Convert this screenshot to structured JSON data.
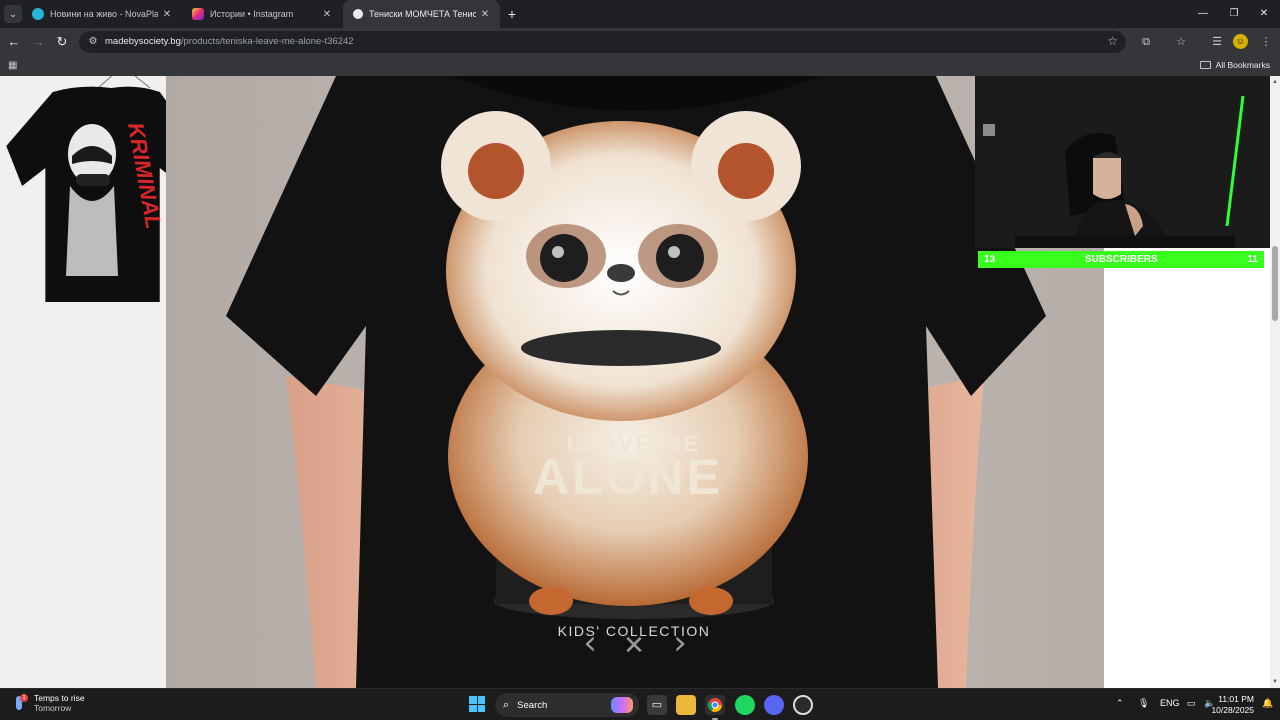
{
  "browser": {
    "tabs": [
      {
        "title": "Новини на живо - NovaPlay",
        "close": "✕"
      },
      {
        "title": "Истории • Instagram",
        "close": "✕"
      },
      {
        "title": "Тениски МОМЧЕТА Тениска ЛЕА",
        "close": "✕"
      }
    ],
    "new_tab": "+",
    "window_controls": {
      "minimize": "—",
      "restore": "❐",
      "close": "✕"
    },
    "url_domain": "madebysociety.bg",
    "url_path": "/products/teniska-leave-me-alone-t36242",
    "bookmarks_label": "All Bookmarks"
  },
  "product": {
    "print_title_small": "LEAVE ME",
    "print_title_big": "ALONE",
    "print_footer": "KIDS' COLLECTION",
    "thumb_text": "KRIMINAL",
    "gallery_prev": "‹",
    "gallery_close": "✕",
    "gallery_next": "›"
  },
  "overlay": {
    "left_count": "13",
    "label": "SUBSCRIBERS",
    "right_count": "11"
  },
  "taskbar": {
    "weather_title": "Temps to rise",
    "weather_sub": "Tomorrow",
    "weather_badge": "1",
    "search_placeholder": "Search",
    "lang": "ENG",
    "time": "11:01 PM",
    "date": "10/28/2025"
  },
  "colors": {
    "accent_green": "#39ff1f",
    "browser_dark": "#35363a",
    "taskbar_dark": "#1c1c1c"
  }
}
